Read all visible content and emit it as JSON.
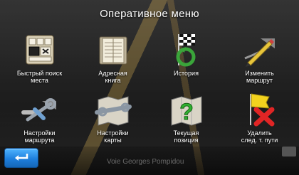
{
  "header": {
    "title": "Оперативное меню"
  },
  "tiles": [
    {
      "label": "Быстрый поиск\nместа",
      "icon": "keyboard-icon"
    },
    {
      "label": "Адресная\nкнига",
      "icon": "book-icon"
    },
    {
      "label": "История",
      "icon": "history-flag-icon"
    },
    {
      "label": "Изменить\nмаршрут",
      "icon": "edit-route-icon"
    },
    {
      "label": "Настройки\nмаршрута",
      "icon": "route-settings-icon"
    },
    {
      "label": "Настройки\nкарты",
      "icon": "map-settings-icon"
    },
    {
      "label": "Текущая\nпозиция",
      "icon": "current-position-icon"
    },
    {
      "label": "Удалить\nслед. т. пути",
      "icon": "delete-waypoint-icon"
    }
  ],
  "footer": {
    "street": "Voie Georges Pompidou"
  },
  "colors": {
    "accent": "#1e7fdd",
    "title_text": "#ffffff"
  }
}
